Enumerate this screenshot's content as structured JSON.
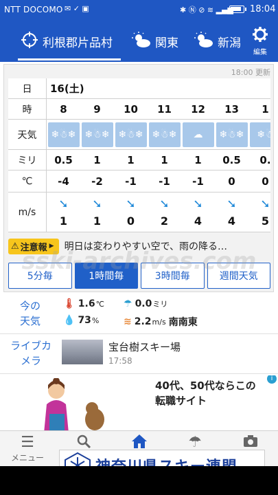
{
  "status_bar": {
    "carrier": "NTT DOCOMO",
    "time": "18:04"
  },
  "header": {
    "locations": [
      {
        "label": "利根郡片品村",
        "icon": "crosshair-icon",
        "selected": true
      },
      {
        "label": "関東",
        "icon": "partly-cloudy-icon"
      },
      {
        "label": "新潟",
        "icon": "partly-cloudy-icon"
      }
    ],
    "edit_label": "編集",
    "edit_icon": "gear-icon"
  },
  "forecast": {
    "updated": "18:00 更新",
    "row_labels": {
      "day": "日",
      "hour": "時",
      "weather": "天気",
      "precip": "ミリ",
      "temp": "℃",
      "wind": "m/s"
    },
    "day": "16(土)",
    "hours": [
      "8",
      "9",
      "10",
      "11",
      "12",
      "13",
      "1"
    ],
    "weather": [
      {
        "icon": "snow-icon",
        "glyph": "❄☃❄"
      },
      {
        "icon": "snow-icon",
        "glyph": "❄☃❄"
      },
      {
        "icon": "snow-icon",
        "glyph": "❄☃❄"
      },
      {
        "icon": "snow-icon",
        "glyph": "❄☃❄"
      },
      {
        "icon": "snow-cloud-icon",
        "glyph": "☁"
      },
      {
        "icon": "snow-icon",
        "glyph": "❄☃❄"
      },
      {
        "icon": "snow-icon",
        "glyph": "❄☃"
      }
    ],
    "precip": [
      "0.5",
      "1",
      "1",
      "1",
      "1",
      "0.5",
      "0."
    ],
    "temp": [
      "-4",
      "-2",
      "-1",
      "-1",
      "-1",
      "0",
      "0"
    ],
    "wind": [
      {
        "speed": "1",
        "arrow": "➘"
      },
      {
        "speed": "1",
        "arrow": "➘"
      },
      {
        "speed": "0",
        "arrow": "➘"
      },
      {
        "speed": "2",
        "arrow": "➘"
      },
      {
        "speed": "4",
        "arrow": "➘"
      },
      {
        "speed": "4",
        "arrow": "➘"
      },
      {
        "speed": "5",
        "arrow": "➘"
      }
    ],
    "warning_badge": "注意報",
    "warning_text": "明日は変わりやすい空で、雨の降る…"
  },
  "tabs": [
    "5分毎",
    "1時間毎",
    "3時間毎",
    "週間天気"
  ],
  "current": {
    "title": "今の天気",
    "temp_value": "1.6",
    "temp_unit": "℃",
    "precip_value": "0.0",
    "precip_unit": "ミリ",
    "humidity_value": "73",
    "humidity_unit": "%",
    "wind_value": "2.2",
    "wind_unit": "m/s",
    "wind_dir": "南南東"
  },
  "live_camera": {
    "title": "ライブカメラ",
    "name": "宝台樹スキー場",
    "time": "17:58"
  },
  "ad": {
    "line1": "40代、50代ならこの",
    "line2": "転職サイト",
    "info": "i"
  },
  "bottom_nav": [
    {
      "label": "メニュー",
      "icon": "menu-icon",
      "glyph": "☰"
    },
    {
      "label": "",
      "icon": "search-icon",
      "glyph": "🔍"
    },
    {
      "label": "",
      "icon": "home-icon",
      "glyph": "⌂"
    },
    {
      "label": "",
      "icon": "umbrella-icon",
      "glyph": "☂"
    },
    {
      "label": "",
      "icon": "camera-icon",
      "glyph": "📷"
    }
  ],
  "overlay": {
    "watermark": "sski-archives.com",
    "stamp": "神奈川県スキー連盟"
  },
  "colors": {
    "brand_blue": "#1f57c3",
    "weather_tile": "#a8c8ea",
    "warning_yellow": "#f7c51c",
    "accent_text": "#2b6fd1"
  }
}
